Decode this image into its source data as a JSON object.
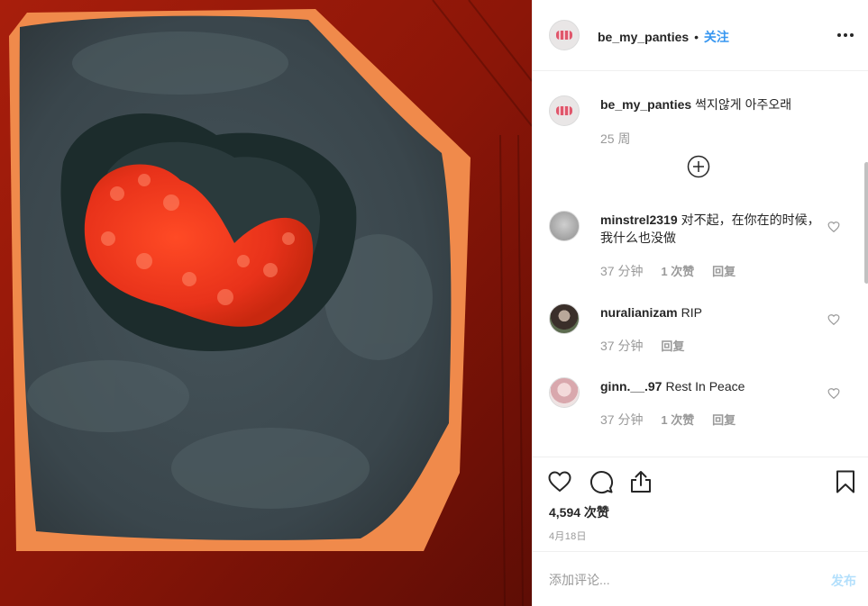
{
  "header": {
    "username": "be_my_panties",
    "separator": "•",
    "follow_label": "关注",
    "more_icon": "more-horizontal-icon"
  },
  "caption": {
    "username": "be_my_panties",
    "text": "썩지않게 아주오래",
    "time": "25 周"
  },
  "comments": [
    {
      "username": "minstrel2319",
      "text": "对不起，在你在的时候，我什么也没做",
      "time": "37 分钟",
      "likes": "1 次赞",
      "reply": "回复"
    },
    {
      "username": "nuralianizam",
      "text": "RIP",
      "time": "37 分钟",
      "likes": "",
      "reply": "回复"
    },
    {
      "username": "ginn.__.97",
      "text": "Rest In Peace",
      "time": "37 分钟",
      "likes": "1 次赞",
      "reply": "回复"
    }
  ],
  "actions": {
    "icons": [
      "heart-icon",
      "comment-icon",
      "share-icon",
      "bookmark-icon"
    ],
    "likes_count": "4,594 次赞",
    "date": "4月18日"
  },
  "add_comment": {
    "placeholder": "添加评论...",
    "post_label": "发布"
  },
  "colors": {
    "accent": "#3897f0",
    "post_disabled": "#b2dffc",
    "border": "#efefef",
    "muted_text": "#999999"
  }
}
